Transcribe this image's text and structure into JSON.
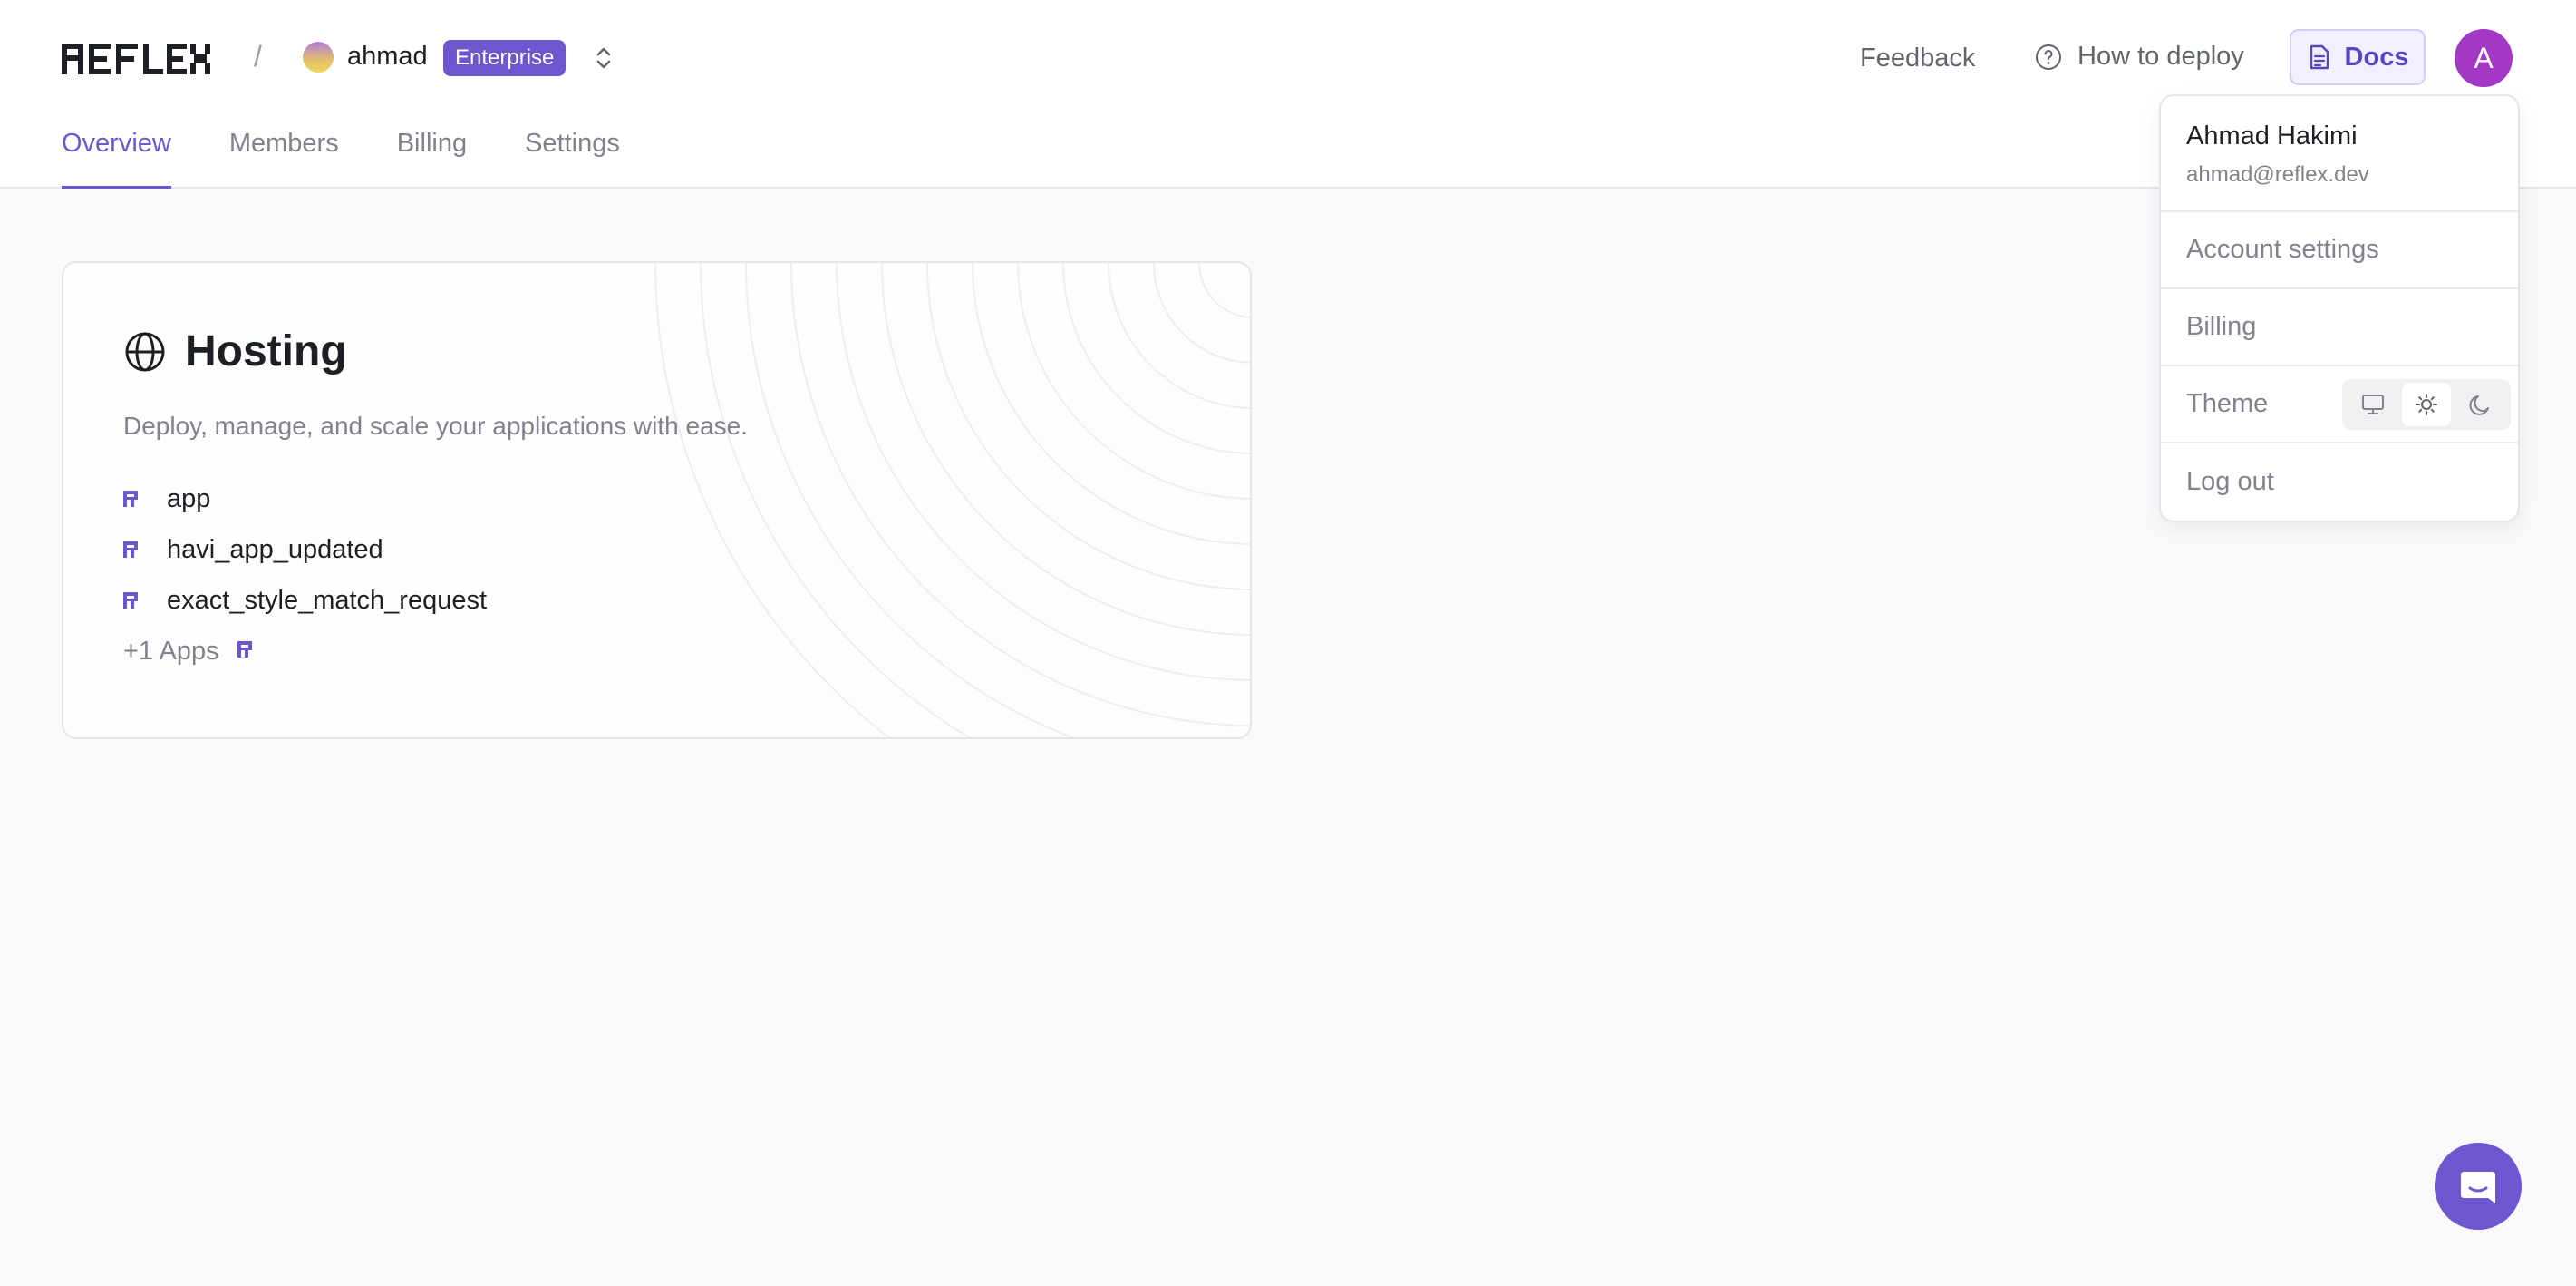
{
  "header": {
    "logo_text": "REFLEX",
    "separator": "/",
    "team": {
      "name": "ahmad",
      "plan_badge": "Enterprise"
    },
    "links": {
      "feedback": "Feedback",
      "how_to_deploy": "How to deploy",
      "docs": "Docs"
    },
    "avatar_initial": "A"
  },
  "tabs": [
    {
      "label": "Overview",
      "active": true
    },
    {
      "label": "Members",
      "active": false
    },
    {
      "label": "Billing",
      "active": false
    },
    {
      "label": "Settings",
      "active": false
    }
  ],
  "hosting_card": {
    "title": "Hosting",
    "description": "Deploy, manage, and scale your applications with ease.",
    "apps": [
      "app",
      "havi_app_updated",
      "exact_style_match_request"
    ],
    "more_label": "+1 Apps"
  },
  "user_menu": {
    "name": "Ahmad Hakimi",
    "email": "ahmad@reflex.dev",
    "items": [
      "Account settings",
      "Billing",
      "Theme",
      "Log out"
    ],
    "theme_options": [
      "system",
      "light",
      "dark"
    ],
    "theme_selected": "light"
  },
  "colors": {
    "accent": "#6e56cf",
    "avatar": "#a238c4",
    "background": "#f9f9fb"
  },
  "icons": [
    "globe-icon",
    "reflex-r-icon",
    "question-circle-icon",
    "document-icon",
    "chevron-up-down-icon",
    "monitor-icon",
    "sun-icon",
    "moon-icon",
    "chat-icon"
  ]
}
